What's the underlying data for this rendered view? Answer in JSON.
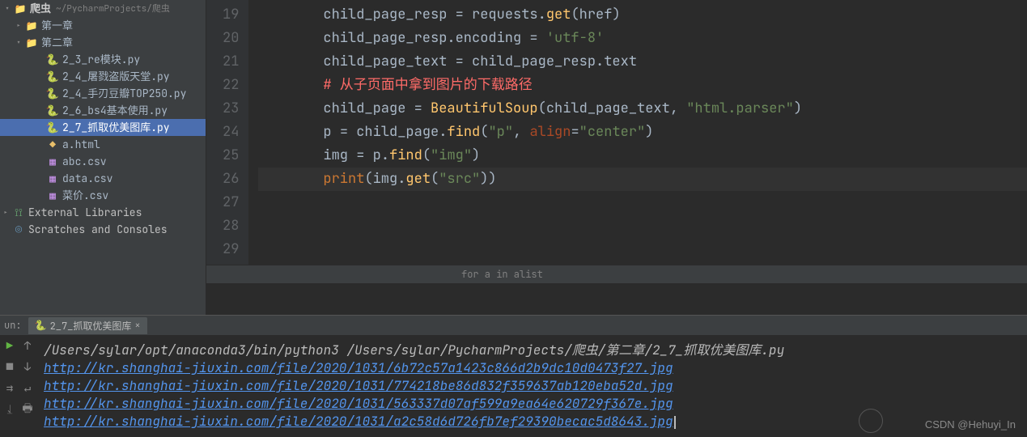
{
  "project": {
    "root_name": "爬虫",
    "root_hint": "~/PycharmProjects/爬虫",
    "folders": [
      {
        "name": "第一章",
        "expanded": false
      },
      {
        "name": "第二章",
        "expanded": true
      }
    ],
    "files": [
      {
        "name": "2_3_re模块.py",
        "type": "py"
      },
      {
        "name": "2_4_屠戮盗版天堂.py",
        "type": "py"
      },
      {
        "name": "2_4_手刃豆瓣TOP250.py",
        "type": "py"
      },
      {
        "name": "2_6_bs4基本使用.py",
        "type": "py"
      },
      {
        "name": "2_7_抓取优美图库.py",
        "type": "py",
        "selected": true
      },
      {
        "name": "a.html",
        "type": "html"
      },
      {
        "name": "abc.csv",
        "type": "csv"
      },
      {
        "name": "data.csv",
        "type": "csv"
      },
      {
        "name": "菜价.csv",
        "type": "csv"
      }
    ],
    "external": "External Libraries",
    "scratches": "Scratches and Consoles"
  },
  "code": {
    "lines": [
      {
        "n": 19,
        "tokens": [
          [
            "id",
            "child_page_resp "
          ],
          [
            "op",
            "= "
          ],
          [
            "id",
            "requests"
          ],
          [
            "op",
            "."
          ],
          [
            "fn",
            "get"
          ],
          [
            "op",
            "("
          ],
          [
            "id",
            "href"
          ],
          [
            "op",
            ")"
          ]
        ]
      },
      {
        "n": 20,
        "tokens": [
          [
            "id",
            "child_page_resp"
          ],
          [
            "op",
            "."
          ],
          [
            "id",
            "encoding "
          ],
          [
            "op",
            "= "
          ],
          [
            "s",
            "'utf-8'"
          ]
        ]
      },
      {
        "n": 21,
        "tokens": [
          [
            "id",
            "child_page_text "
          ],
          [
            "op",
            "= "
          ],
          [
            "id",
            "child_page_resp"
          ],
          [
            "op",
            "."
          ],
          [
            "id",
            "text"
          ]
        ]
      },
      {
        "n": 22,
        "tokens": [
          [
            "c",
            "# 从子页面中拿到图片的下载路径"
          ]
        ]
      },
      {
        "n": 23,
        "tokens": [
          [
            "id",
            "child_page "
          ],
          [
            "op",
            "= "
          ],
          [
            "fn",
            "BeautifulSoup"
          ],
          [
            "op",
            "("
          ],
          [
            "id",
            "child_page_text"
          ],
          [
            "op",
            ", "
          ],
          [
            "s",
            "\"html.parser\""
          ],
          [
            "op",
            ")"
          ]
        ]
      },
      {
        "n": 24,
        "tokens": [
          [
            "id",
            "p "
          ],
          [
            "op",
            "= "
          ],
          [
            "id",
            "child_page"
          ],
          [
            "op",
            "."
          ],
          [
            "fn",
            "find"
          ],
          [
            "op",
            "("
          ],
          [
            "s",
            "\"p\""
          ],
          [
            "op",
            ", "
          ],
          [
            "kw",
            "align"
          ],
          [
            "op",
            "="
          ],
          [
            "s",
            "\"center\""
          ],
          [
            "op",
            ")"
          ]
        ]
      },
      {
        "n": 25,
        "tokens": [
          [
            "id",
            "img "
          ],
          [
            "op",
            "= "
          ],
          [
            "id",
            "p"
          ],
          [
            "op",
            "."
          ],
          [
            "fn",
            "find"
          ],
          [
            "op",
            "("
          ],
          [
            "s",
            "\"img\""
          ],
          [
            "op",
            ")"
          ]
        ]
      },
      {
        "n": 26,
        "hl": true,
        "tokens": [
          [
            "k",
            "print"
          ],
          [
            "op",
            "("
          ],
          [
            "id",
            "img"
          ],
          [
            "op",
            "."
          ],
          [
            "fn",
            "get"
          ],
          [
            "op",
            "("
          ],
          [
            "s",
            "\"src\""
          ],
          [
            "op",
            "))"
          ]
        ]
      },
      {
        "n": 27,
        "tokens": []
      },
      {
        "n": 28,
        "tokens": []
      },
      {
        "n": 29,
        "tokens": []
      }
    ],
    "breadcrumb": "for a in alist"
  },
  "run": {
    "label": "un:",
    "tab_name": "2_7_抓取优美图库",
    "command": "/Users/sylar/opt/anaconda3/bin/python3 /Users/sylar/PycharmProjects/爬虫/第二章/2_7_抓取优美图库.py",
    "output": [
      "http://kr.shanghai-jiuxin.com/file/2020/1031/6b72c57a1423c866d2b9dc10d0473f27.jpg",
      "http://kr.shanghai-jiuxin.com/file/2020/1031/774218be86d832f359637ab120eba52d.jpg",
      "http://kr.shanghai-jiuxin.com/file/2020/1031/563337d07af599a9ea64e620729f367e.jpg",
      "http://kr.shanghai-jiuxin.com/file/2020/1031/a2c58d6d726fb7ef29390becac5d8643.jpg"
    ]
  },
  "watermark": "CSDN @Hehuyi_In"
}
